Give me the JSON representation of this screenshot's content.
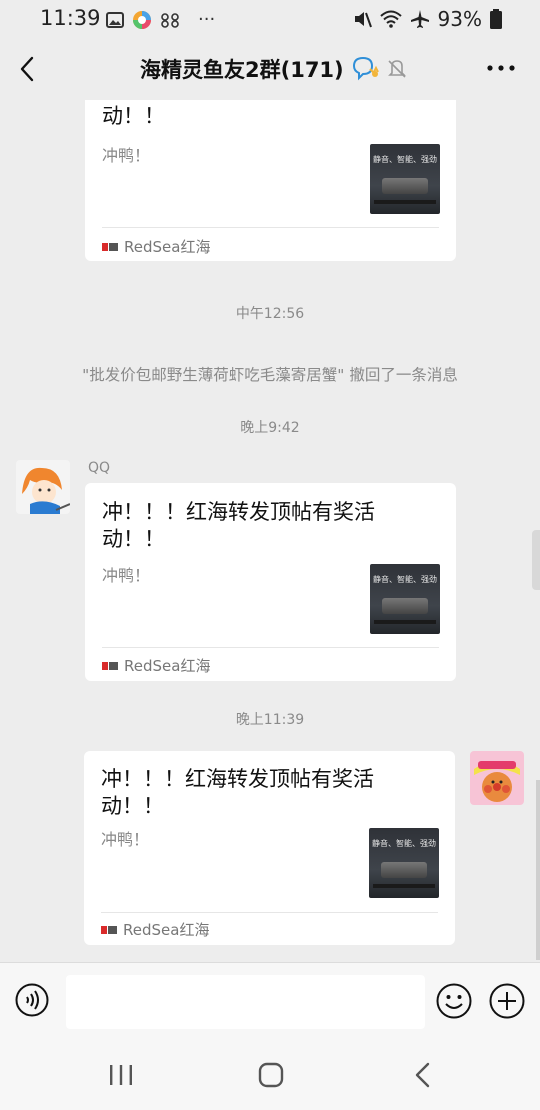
{
  "status_bar": {
    "time": "11:39",
    "battery": "93%",
    "overflow": "···"
  },
  "header": {
    "title": "海精灵鱼友2群(171)",
    "back_icon": "back-arrow-icon",
    "more_icon": "more-dots-icon"
  },
  "messages": {
    "card1": {
      "title": "冲！！！红海转发顶帖有奖活动！！",
      "desc": "冲鸭！",
      "thumb_text": "静音、智能、强劲",
      "source": "RedSea红海"
    },
    "time1": "中午12:56",
    "notice": "\"批发价包邮野生薄荷虾吃毛藻寄居蟹\" 撤回了一条消息",
    "time2": "晚上9:42",
    "sender2": "QQ",
    "card2": {
      "title": "冲！！！红海转发顶帖有奖活动！！",
      "desc": "冲鸭！",
      "thumb_text": "静音、智能、强劲",
      "source": "RedSea红海"
    },
    "time3": "晚上11:39",
    "card3": {
      "title": "冲！！！红海转发顶帖有奖活动！！",
      "desc": "冲鸭！",
      "thumb_text": "静音、智能、强劲",
      "source": "RedSea红海"
    }
  },
  "input_bar": {
    "voice_icon": "voice-icon",
    "input_value": "",
    "emoji_icon": "emoji-icon",
    "plus_icon": "plus-icon"
  },
  "colors": {
    "background": "#ededed",
    "card": "#ffffff",
    "muted_text": "#8a8a8a",
    "redsea_red": "#d92b2b"
  }
}
